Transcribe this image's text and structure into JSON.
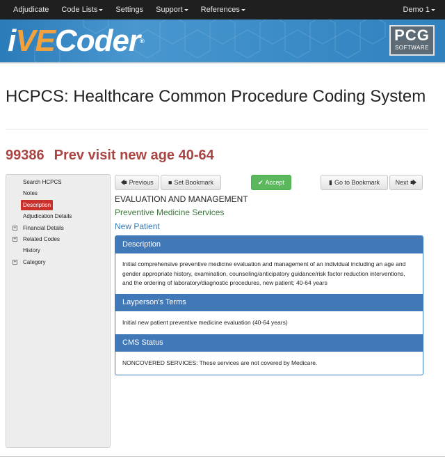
{
  "nav": {
    "items": [
      {
        "label": "Adjudicate",
        "dropdown": false
      },
      {
        "label": "Code Lists",
        "dropdown": true
      },
      {
        "label": "Settings",
        "dropdown": false
      },
      {
        "label": "Support",
        "dropdown": true
      },
      {
        "label": "References",
        "dropdown": true
      }
    ],
    "user": "Demo 1"
  },
  "banner": {
    "logo_prefix": "i",
    "logo_highlight": "VE",
    "logo_suffix": "Coder",
    "logo_mark": "®",
    "vendor_line1": "PCG",
    "vendor_line2": "SOFTWARE"
  },
  "page": {
    "title": "HCPCS: Healthcare Common Procedure Coding System",
    "code": "99386",
    "code_description": "Prev visit new age 40-64"
  },
  "sidebar": {
    "items": [
      {
        "label": "Search HCPCS",
        "expandable": false,
        "active": false
      },
      {
        "label": "Notes",
        "expandable": false,
        "active": false
      },
      {
        "label": "Description",
        "expandable": false,
        "active": true
      },
      {
        "label": "Adjudication Details",
        "expandable": false,
        "active": false
      },
      {
        "label": "Financial Details",
        "expandable": true,
        "active": false
      },
      {
        "label": "Related Codes",
        "expandable": true,
        "active": false
      },
      {
        "label": "History",
        "expandable": false,
        "active": false
      },
      {
        "label": "Category",
        "expandable": true,
        "active": false
      }
    ]
  },
  "toolbar": {
    "previous": "Previous",
    "set_bookmark": "Set Bookmark",
    "accept": "Accept",
    "goto_bookmark": "Go to Bookmark",
    "next": "Next"
  },
  "content": {
    "category": "EVALUATION AND MANAGEMENT",
    "subcategory": "Preventive Medicine Services",
    "patient_type": "New Patient",
    "panels": {
      "description_title": "Description",
      "description_text": "Initial comprehensive preventive medicine evaluation and management of an individual including an age and gender appropriate history, examination, counseling/anticipatory guidance/risk factor reduction interventions, and the ordering of laboratory/diagnostic procedures, new patient; 40-64 years",
      "layperson_title": "Layperson's Terms",
      "layperson_text": "Initial new patient preventive medicine evaluation (40-64 years)",
      "cms_title": "CMS Status",
      "cms_text": "NONCOVERED SERVICES: These services are not covered by Medicare."
    }
  },
  "colors": {
    "nav_bg": "#1f1f1f",
    "banner_blue": "#3c8dc8",
    "logo_accent": "#f2a23c",
    "code_red": "#a94442",
    "accept_green": "#5cb85c",
    "panel_header": "#4178b8",
    "subcategory_green": "#3c763d",
    "patient_blue": "#337ab7"
  },
  "icons": {
    "previous": "arrow-left-icon",
    "set_bookmark": "book-icon",
    "accept": "checkmark-icon",
    "goto_bookmark": "bookmark-icon",
    "next": "arrow-right-icon",
    "expand": "plus-square-icon"
  }
}
